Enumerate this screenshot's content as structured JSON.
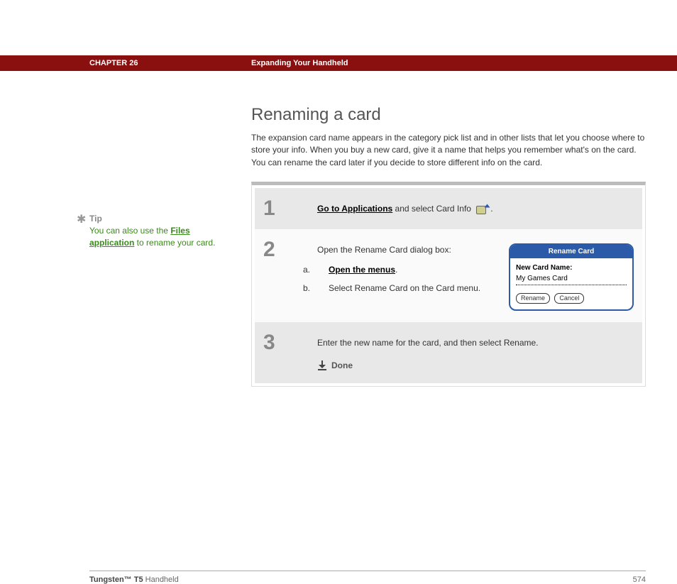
{
  "header": {
    "chapter": "CHAPTER 26",
    "title": "Expanding Your Handheld"
  },
  "heading": "Renaming a card",
  "intro": "The expansion card name appears in the category pick list and in other lists that let you choose where to store your info. When you buy a new card, give it a name that helps you remember what's on the card. You can rename the card later if you decide to store different info on the card.",
  "tip": {
    "label": "Tip",
    "pre": "You can also use the ",
    "link": "Files application",
    "post": " to rename your card."
  },
  "steps": {
    "s1": {
      "num": "1",
      "link": "Go to Applications",
      "rest": " and select Card Info ",
      "end": "."
    },
    "s2": {
      "num": "2",
      "lead": "Open the Rename Card dialog box:",
      "a_marker": "a.",
      "a_link": "Open the menus",
      "a_end": ".",
      "b_marker": "b.",
      "b_text": "Select Rename Card on the Card menu."
    },
    "s3": {
      "num": "3",
      "text": "Enter the new name for the card, and then select Rename.",
      "done": "Done"
    }
  },
  "dialog": {
    "title": "Rename Card",
    "label": "New Card Name:",
    "value": "My Games Card",
    "rename": "Rename",
    "cancel": "Cancel"
  },
  "footer": {
    "product_bold": "Tungsten™ T5",
    "product_rest": " Handheld",
    "page": "574"
  }
}
